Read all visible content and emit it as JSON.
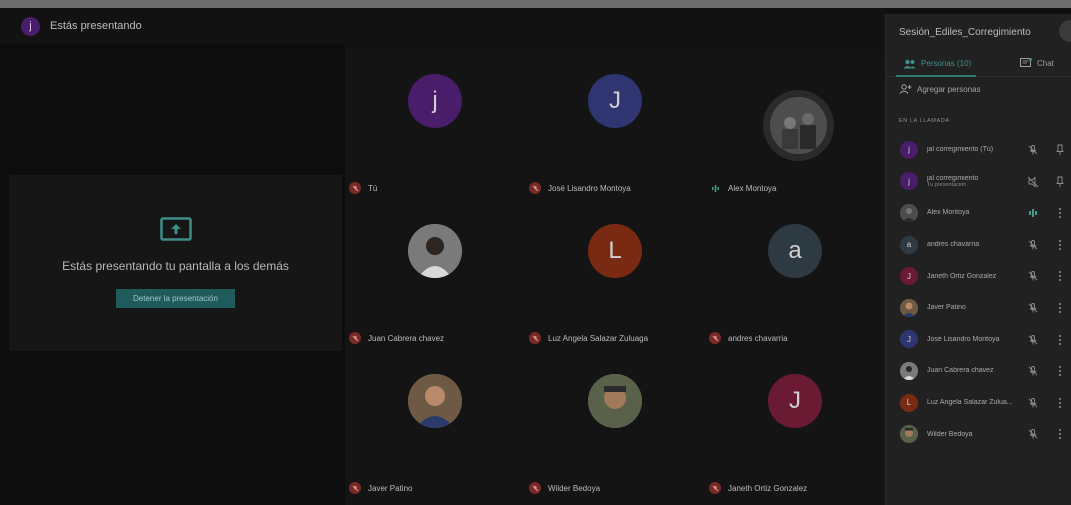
{
  "presenting_bar": {
    "avatar_letter": "j",
    "text": "Estás presentando"
  },
  "present_card": {
    "message": "Estás presentando tu pantalla a los demás",
    "stop_button": "Detener la presentación"
  },
  "tiles": [
    {
      "name": "Tú",
      "letter": "j",
      "color": "#4a1d6a",
      "mic": "muted",
      "photo": false
    },
    {
      "name": "José Lisandro Montoya",
      "letter": "J",
      "color": "#2f3570",
      "mic": "muted",
      "photo": false
    },
    {
      "name": "Alex Montoya",
      "letter": "",
      "color": "#555555",
      "mic": "speaking",
      "photo": true
    },
    {
      "name": "Juan Cabrera chavez",
      "letter": "",
      "color": "#6b6b6b",
      "mic": "muted",
      "photo": true
    },
    {
      "name": "Luz Angela Salazar Zuluaga",
      "letter": "L",
      "color": "#7a2a12",
      "mic": "muted",
      "photo": false
    },
    {
      "name": "andres chavarria",
      "letter": "a",
      "color": "#2e3a42",
      "mic": "muted",
      "photo": false
    },
    {
      "name": "Javer Patino",
      "letter": "",
      "color": "#5e5040",
      "mic": "muted",
      "photo": true
    },
    {
      "name": "Wilder Bedoya",
      "letter": "",
      "color": "#4e4a3e",
      "mic": "muted",
      "photo": true
    },
    {
      "name": "Janeth Ortiz Gonzalez",
      "letter": "J",
      "color": "#6a1a33",
      "mic": "muted",
      "photo": false
    }
  ],
  "panel": {
    "title": "Sesión_Ediles_Corregimiento",
    "tab_people": "Personas (10)",
    "tab_chat": "Chat",
    "add_people": "Agregar personas",
    "section_label": "EN LA LLAMADA",
    "participants": [
      {
        "name": "jal corregimiento (Tú)",
        "sub": "",
        "letter": "j",
        "color": "#4a1d6a",
        "mic": "muted",
        "action": "pin"
      },
      {
        "name": "jal corregimiento",
        "sub": "Tu presentación",
        "letter": "j",
        "color": "#4a1d6a",
        "mic": "present-muted",
        "action": "pin"
      },
      {
        "name": "Alex Montoya",
        "sub": "",
        "letter": "",
        "color": "#555555",
        "mic": "speaking",
        "action": "more"
      },
      {
        "name": "andres chavarria",
        "sub": "",
        "letter": "a",
        "color": "#2e3a42",
        "mic": "muted",
        "action": "more"
      },
      {
        "name": "Janeth Ortiz Gonzalez",
        "sub": "",
        "letter": "J",
        "color": "#6a1a33",
        "mic": "muted",
        "action": "more"
      },
      {
        "name": "Javer Patino",
        "sub": "",
        "letter": "",
        "color": "#5e5040",
        "mic": "muted",
        "action": "more"
      },
      {
        "name": "José Lisandro Montoya",
        "sub": "",
        "letter": "J",
        "color": "#2f3570",
        "mic": "muted",
        "action": "more"
      },
      {
        "name": "Juan Cabrera chavez",
        "sub": "",
        "letter": "",
        "color": "#6b6b6b",
        "mic": "muted",
        "action": "more"
      },
      {
        "name": "Luz Angela Salazar Zulua...",
        "sub": "",
        "letter": "L",
        "color": "#7a2a12",
        "mic": "muted",
        "action": "more"
      },
      {
        "name": "Wilder Bedoya",
        "sub": "",
        "letter": "",
        "color": "#4e4a3e",
        "mic": "muted",
        "action": "more"
      }
    ]
  }
}
